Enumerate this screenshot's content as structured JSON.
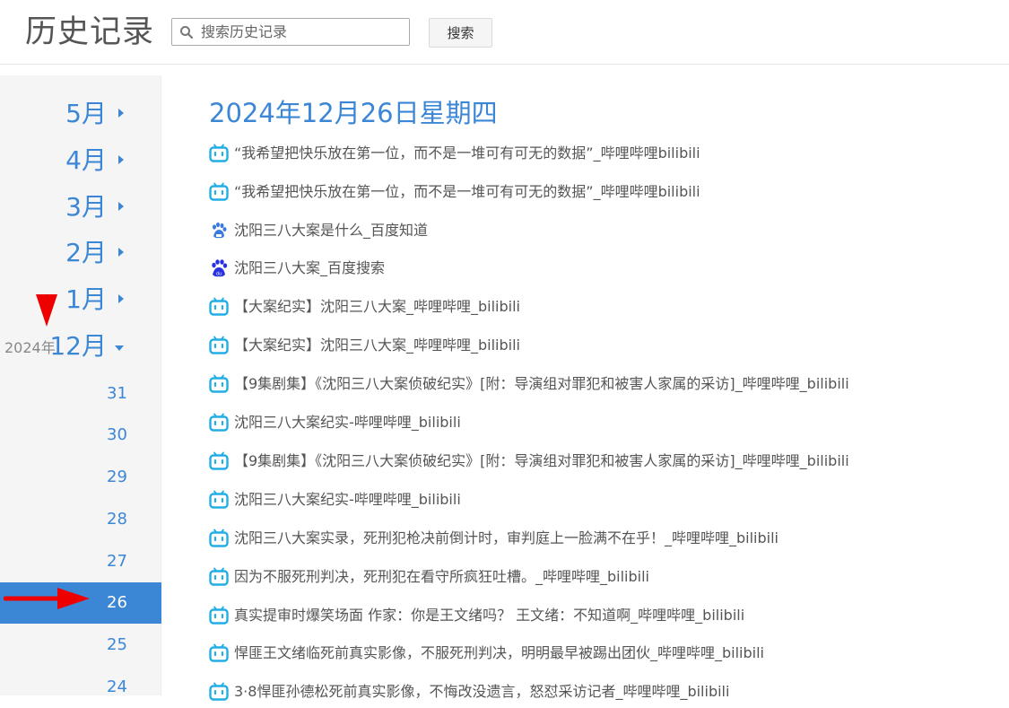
{
  "header": {
    "title": "历史记录",
    "search_placeholder": "搜索历史记录",
    "search_value": "",
    "search_button": "搜索"
  },
  "sidebar": {
    "months": [
      {
        "label": "5月",
        "expanded": false
      },
      {
        "label": "4月",
        "expanded": false
      },
      {
        "label": "3月",
        "expanded": false
      },
      {
        "label": "2月",
        "expanded": false
      },
      {
        "label": "1月",
        "expanded": false
      },
      {
        "label": "12月",
        "year": "2024年",
        "expanded": true
      }
    ],
    "days": [
      {
        "label": "31"
      },
      {
        "label": "30"
      },
      {
        "label": "29"
      },
      {
        "label": "28"
      },
      {
        "label": "27"
      },
      {
        "label": "26",
        "active": true
      },
      {
        "label": "25"
      },
      {
        "label": "24"
      }
    ]
  },
  "main": {
    "date_heading": "2024年12月26日星期四",
    "items": [
      {
        "icon": "bilibili-icon",
        "title": "“我希望把快乐放在第一位，而不是一堆可有可无的数据”_哔哩哔哩bilibili"
      },
      {
        "icon": "bilibili-icon",
        "title": "“我希望把快乐放在第一位，而不是一堆可有可无的数据”_哔哩哔哩bilibili"
      },
      {
        "icon": "baidu-zhidao-icon",
        "title": "沈阳三八大案是什么_百度知道"
      },
      {
        "icon": "baidu-icon",
        "title": "沈阳三八大案_百度搜索"
      },
      {
        "icon": "bilibili-icon",
        "title": "【大案纪实】沈阳三八大案_哔哩哔哩_bilibili"
      },
      {
        "icon": "bilibili-icon",
        "title": "【大案纪实】沈阳三八大案_哔哩哔哩_bilibili"
      },
      {
        "icon": "bilibili-icon",
        "title": "【9集剧集】《沈阳三八大案侦破纪实》[附：导演组对罪犯和被害人家属的采访]_哔哩哔哩_bilibili"
      },
      {
        "icon": "bilibili-icon",
        "title": "沈阳三八大案纪实-哔哩哔哩_bilibili"
      },
      {
        "icon": "bilibili-icon",
        "title": "【9集剧集】《沈阳三八大案侦破纪实》[附：导演组对罪犯和被害人家属的采访]_哔哩哔哩_bilibili"
      },
      {
        "icon": "bilibili-icon",
        "title": "沈阳三八大案纪实-哔哩哔哩_bilibili"
      },
      {
        "icon": "bilibili-icon",
        "title": "沈阳三八大案实录，死刑犯枪决前倒计时，审判庭上一脸满不在乎！_哔哩哔哩_bilibili"
      },
      {
        "icon": "bilibili-icon",
        "title": "因为不服死刑判决，死刑犯在看守所疯狂吐槽。_哔哩哔哩_bilibili"
      },
      {
        "icon": "bilibili-icon",
        "title": "真实提审时爆笑场面 作家：你是王文绪吗？ 王文绪：不知道啊_哔哩哔哩_bilibili"
      },
      {
        "icon": "bilibili-icon",
        "title": "悍匪王文绪临死前真实影像，不服死刑判决，明明最早被踢出团伙_哔哩哔哩_bilibili"
      },
      {
        "icon": "bilibili-icon",
        "title": "3·8悍匪孙德松死前真实影像，不悔改没遗言，怒怼采访记者_哔哩哔哩_bilibili"
      }
    ]
  },
  "colors": {
    "accent": "#3c86d6",
    "sidebar_bg": "#f5f5f5",
    "annotation_red": "#ee0000"
  }
}
